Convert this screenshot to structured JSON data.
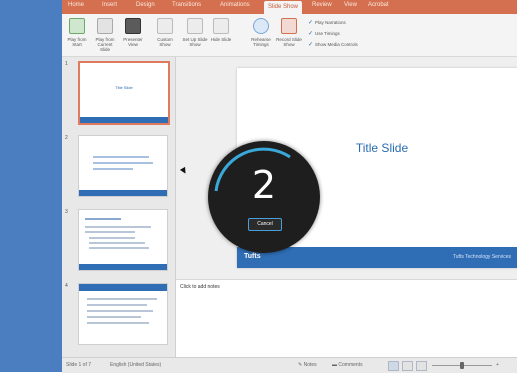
{
  "ribbon_tabs": [
    "Home",
    "Insert",
    "Design",
    "Transitions",
    "Animations",
    "Slide Show",
    "Review",
    "View",
    "Acrobat"
  ],
  "active_tab": "Slide Show",
  "ribbon_buttons": [
    {
      "label": "Play from Start",
      "icon": "play-from-start-icon"
    },
    {
      "label": "Play from Current Slide",
      "icon": "play-from-current-icon"
    },
    {
      "label": "Presenter View",
      "icon": "presenter-view-icon"
    },
    {
      "label": "Custom Show",
      "icon": "custom-show-icon"
    },
    {
      "label": "Set Up Slide Show",
      "icon": "setup-slideshow-icon"
    },
    {
      "label": "Hide Slide",
      "icon": "hide-slide-icon"
    },
    {
      "label": "Rehearse Timings",
      "icon": "rehearse-timings-icon"
    },
    {
      "label": "Record Slide Show",
      "icon": "record-slideshow-icon"
    }
  ],
  "ribbon_checks": [
    "Play Narrations",
    "Use Timings",
    "Show Media Controls"
  ],
  "thumbnails": {
    "numbers": [
      "1",
      "2",
      "3",
      "4"
    ],
    "slide1_title": "Title Slide"
  },
  "slide": {
    "title": "Title Slide",
    "brand": "Tufts",
    "company": "Tufts Technology Services"
  },
  "countdown": {
    "number": "2",
    "cancel_label": "Cancel"
  },
  "notes_placeholder": "Click to add notes",
  "status": {
    "slide_info": "Slide 1 of 7",
    "language": "English (United States)",
    "notes_label": "Notes",
    "comments_label": "Comments"
  },
  "colors": {
    "ribbon_tab_bar": "#d4704f",
    "slide_accent": "#2f6db5",
    "countdown_ring": "#3aa8d8"
  }
}
